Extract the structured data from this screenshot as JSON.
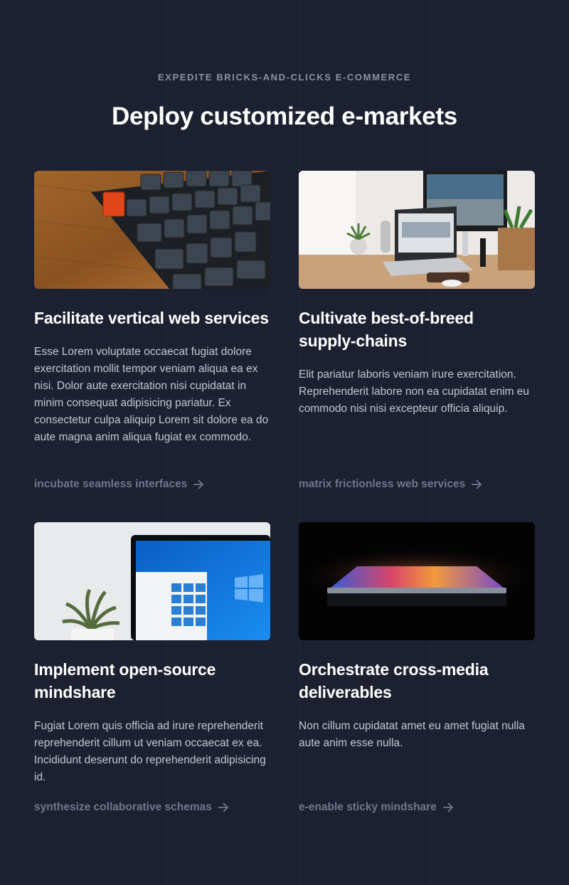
{
  "header": {
    "eyebrow": "EXPEDITE BRICKS-AND-CLICKS E-COMMERCE",
    "title": "Deploy customized e-markets"
  },
  "cards": [
    {
      "image": "keyboard-photo",
      "title": "Facilitate vertical web services",
      "body": "Esse Lorem voluptate occaecat fugiat dolore exercitation mollit tempor veniam aliqua ea ex nisi. Dolor aute exercitation nisi cupidatat in minim consequat adipisicing pariatur. Ex consectetur culpa aliquip Lorem sit dolore ea do aute magna anim aliqua fugiat ex commodo.",
      "link": "incubate seamless interfaces"
    },
    {
      "image": "desk-workspace-photo",
      "title": "Cultivate best-of-breed supply-chains",
      "body": "Elit pariatur laboris veniam irure exercitation. Reprehenderit labore non ea cupidatat enim eu commodo nisi nisi excepteur officia aliquip.",
      "link": "matrix frictionless web services"
    },
    {
      "image": "windows-laptop-photo",
      "title": "Implement open-source mindshare",
      "body": "Fugiat Lorem quis officia ad irure reprehenderit reprehenderit cillum ut veniam occaecat ex ea. Incididunt deserunt do reprehenderit adipisicing id.",
      "link": "synthesize collaborative schemas"
    },
    {
      "image": "glowing-laptop-photo",
      "title": "Orchestrate cross-media deliverables",
      "body": "Non cillum cupidatat amet eu amet fugiat nulla aute anim esse nulla.",
      "link": "e-enable sticky mindshare"
    }
  ],
  "colors": {
    "background": "#1d2030",
    "heading": "#ffffff",
    "body_text": "#c4c8d2",
    "link": "#6f7890",
    "eyebrow": "#8b93a7"
  },
  "icons": {
    "link_arrow": "arrow-right-icon"
  }
}
